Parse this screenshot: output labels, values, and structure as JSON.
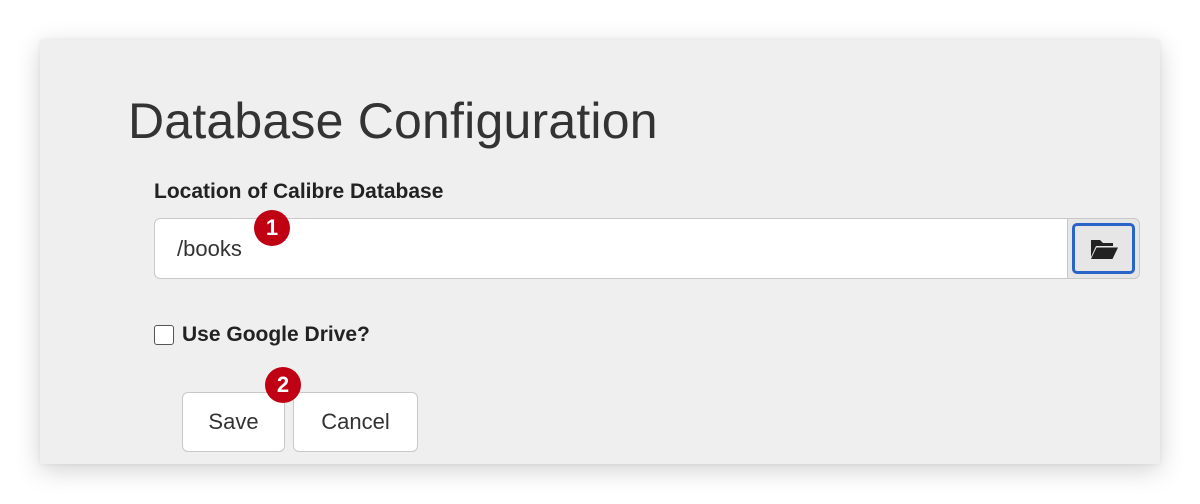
{
  "page": {
    "title": "Database Configuration"
  },
  "location": {
    "label": "Location of Calibre Database",
    "value": "/books",
    "browse_icon": "folder-open-icon"
  },
  "google_drive": {
    "label": "Use Google Drive?",
    "checked": false
  },
  "actions": {
    "save_label": "Save",
    "cancel_label": "Cancel"
  },
  "annotations": {
    "badge_1": "1",
    "badge_2": "2",
    "badge_color": "#c00013"
  },
  "colors": {
    "focus_outline": "#2a64c7",
    "panel_background": "#efefef"
  }
}
